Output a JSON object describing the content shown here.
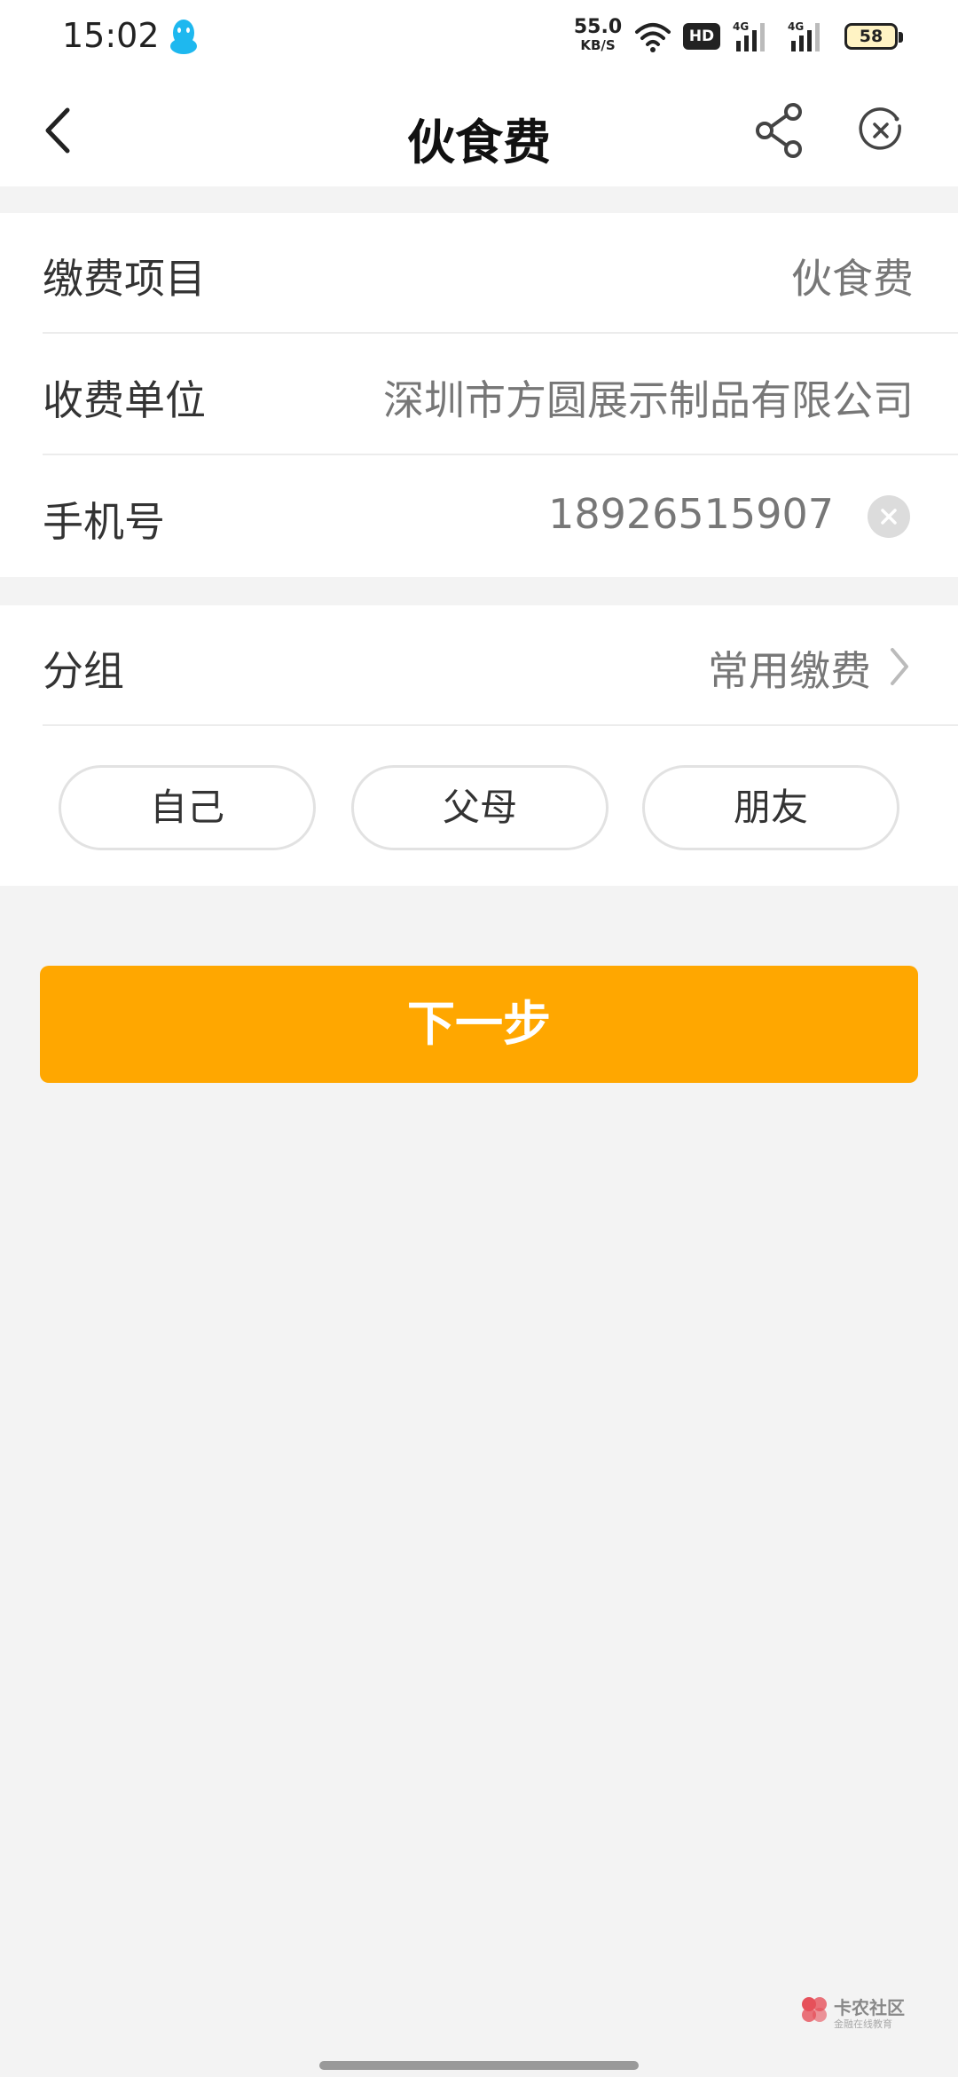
{
  "status_bar": {
    "time": "15:02",
    "net_speed_value": "55.0",
    "net_speed_unit": "KB/S",
    "hd_label": "HD",
    "signal1_label": "4G",
    "signal2_label": "4G",
    "battery": "58",
    "icons": [
      "qq-icon",
      "wifi-icon",
      "hd-icon",
      "signal-icon",
      "battery-icon"
    ]
  },
  "navbar": {
    "title": "伙食费",
    "icons": [
      "back-icon",
      "share-icon",
      "close-icon"
    ]
  },
  "form": {
    "item_label": "缴费项目",
    "item_value": "伙食费",
    "payee_label": "收费单位",
    "payee_value": "深圳市方圆展示制品有限公司",
    "phone_label": "手机号",
    "phone_value": "18926515907"
  },
  "group": {
    "label": "分组",
    "value": "常用缴费",
    "chips": [
      {
        "label": "自己"
      },
      {
        "label": "父母"
      },
      {
        "label": "朋友"
      }
    ]
  },
  "next_button": "下一步",
  "watermark": {
    "title": "卡农社区",
    "subtitle": "金融在线教育"
  },
  "colors": {
    "accent": "#ffa700",
    "background": "#f3f3f3",
    "card": "#ffffff"
  }
}
